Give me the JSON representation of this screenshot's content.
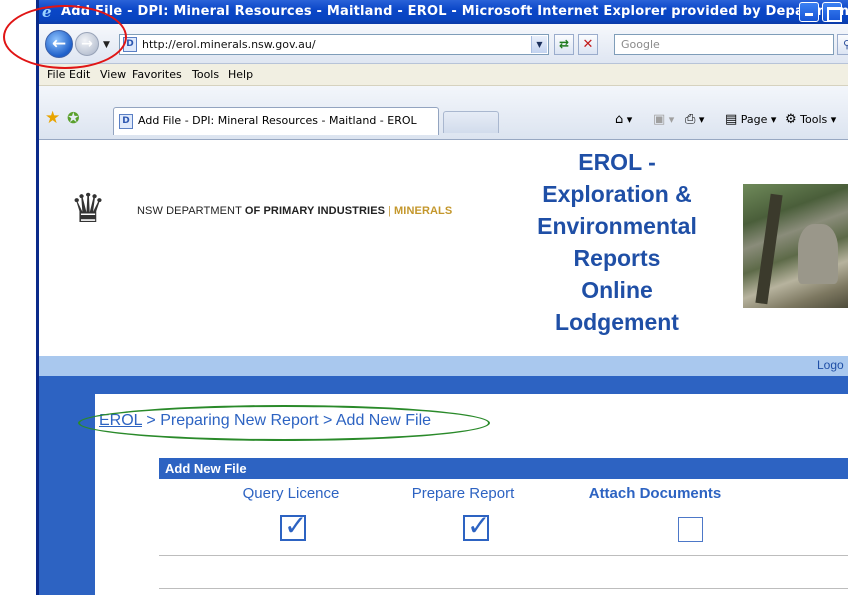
{
  "window": {
    "title": "Add File - DPI: Mineral Resources - Maitland - EROL - Microsoft Internet Explorer provided by Department ..."
  },
  "address_bar": {
    "url": "http://erol.minerals.nsw.gov.au/",
    "search_placeholder": "Google"
  },
  "menu": {
    "file": "File",
    "edit": "Edit",
    "view": "View",
    "favorites": "Favorites",
    "tools": "Tools",
    "help": "Help"
  },
  "tabs": [
    {
      "label": "Add File - DPI: Mineral Resources - Maitland - EROL"
    }
  ],
  "command_bar": {
    "page": "Page",
    "tools": "Tools"
  },
  "header": {
    "dept_prefix": "NSW DEPARTMENT",
    "dept_of": "OF PRIMARY INDUSTRIES",
    "dept_sep": "|",
    "dept_minerals": "MINERALS",
    "title_lines": [
      "EROL -",
      "Exploration &",
      "Environmental",
      "Reports",
      "Online",
      "Lodgement"
    ],
    "logout": "Logo"
  },
  "breadcrumb": {
    "root": "EROL",
    "rest": " > Preparing New Report > Add New File"
  },
  "panel": {
    "title": "Add New File",
    "steps": [
      {
        "label": "Query Licence",
        "checked": true
      },
      {
        "label": "Prepare Report",
        "checked": true
      },
      {
        "label": "Attach Documents",
        "checked": false
      }
    ]
  }
}
